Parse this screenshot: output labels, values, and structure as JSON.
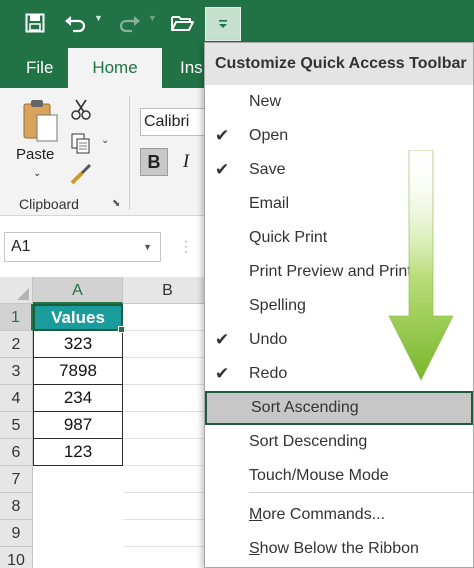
{
  "tabs": {
    "file": "File",
    "home": "Home",
    "insert": "Ins"
  },
  "clipboard": {
    "paste_label": "Paste",
    "group_label": "Clipboard"
  },
  "font": {
    "name": "Calibri",
    "bold": "B",
    "italic": "I"
  },
  "namebox": {
    "value": "A1"
  },
  "grid": {
    "columns": [
      "A",
      "B"
    ],
    "rows": [
      "1",
      "2",
      "3",
      "4",
      "5",
      "6",
      "7",
      "8",
      "9",
      "10"
    ],
    "cells": [
      "Values",
      "323",
      "7898",
      "234",
      "987",
      "123"
    ]
  },
  "menu": {
    "title": "Customize Quick Access Toolbar",
    "items": [
      {
        "label": "New",
        "checked": false
      },
      {
        "label": "Open",
        "checked": true
      },
      {
        "label": "Save",
        "checked": true
      },
      {
        "label": "Email",
        "checked": false
      },
      {
        "label": "Quick Print",
        "checked": false
      },
      {
        "label": "Print Preview and Print",
        "checked": false
      },
      {
        "label": "Spelling",
        "checked": false
      },
      {
        "label": "Undo",
        "checked": true
      },
      {
        "label": "Redo",
        "checked": true
      },
      {
        "label": "Sort Ascending",
        "checked": false,
        "highlighted": true
      },
      {
        "label": "Sort Descending",
        "checked": false
      },
      {
        "label": "Touch/Mouse Mode",
        "checked": false
      }
    ],
    "more_commands": {
      "accel": "M",
      "rest": "ore Commands..."
    },
    "show_below": {
      "accel": "S",
      "rest": "how Below the Ribbon"
    },
    "check_glyph": "✔"
  },
  "colors": {
    "excel_green": "#217346",
    "header_fill": "#1a9c9c",
    "arrow": "#8cc63f"
  }
}
